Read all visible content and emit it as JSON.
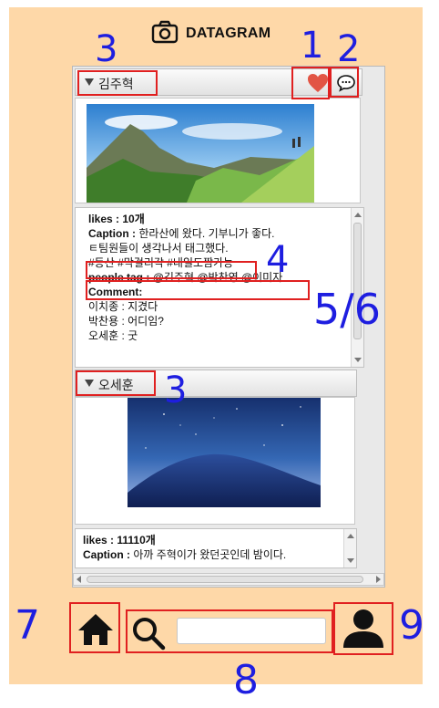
{
  "app": {
    "title": "DATAGRAM",
    "title_icon": "camera-icon"
  },
  "posts": [
    {
      "author": "김주혁",
      "photo": "mountain-landscape-photo",
      "likes_label": "likes :",
      "likes_value": "10개",
      "caption_label": "Caption :",
      "caption_value": "한라산에 왔다. 기부니가 좋다.",
      "caption_line2": "ㅌ팀원들이 생각나서 태그했다.",
      "hashtags": "#등산 #막걸리각 #내일도짬가능",
      "people_tag_label": "people tag :",
      "people_tag_value": "@김주혁 @박찬영 @이미자",
      "comment_label": "Comment:",
      "comments": [
        {
          "user": "이치종",
          "sep": " : ",
          "text": "지겼다"
        },
        {
          "user": "박찬용",
          "sep": " : ",
          "text": "어디임?"
        },
        {
          "user": "오세훈",
          "sep": " : ",
          "text": "굿"
        }
      ]
    },
    {
      "author": "오세훈",
      "photo": "night-sky-photo",
      "likes_label": "likes :",
      "likes_value": "11110개",
      "caption_label": "Caption :",
      "caption_value": "아까 주혁이가 왔던곳인데 밤이다."
    }
  ],
  "icons": {
    "like": "heart-icon",
    "comment": "speech-bubble-icon",
    "home": "home-icon",
    "search": "search-icon",
    "profile": "user-icon"
  },
  "search": {
    "value": "",
    "placeholder": ""
  },
  "annotations": {
    "n1": "1",
    "n2": "2",
    "n3a": "3",
    "n3b": "3",
    "n4": "4",
    "n56": "5/6",
    "n7": "7",
    "n8": "8",
    "n9": "9"
  },
  "colors": {
    "background": "#fed8a8",
    "highlight": "#e02020",
    "annotation": "#1e1ee0",
    "heart": "#e25545"
  }
}
